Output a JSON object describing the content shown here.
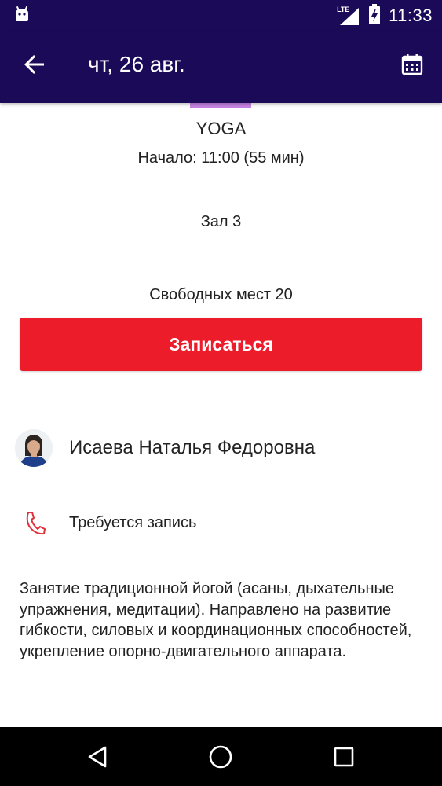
{
  "status_bar": {
    "time": "11:33",
    "network_label": "LTE",
    "left_icon": "android-debug-icon",
    "right_icons": [
      "lte-signal-icon",
      "battery-charging-icon"
    ]
  },
  "app_bar": {
    "title": "чт, 26 авг.",
    "back_icon": "arrow-back-icon",
    "calendar_icon": "calendar-icon",
    "background_color": "#1a0a57"
  },
  "session": {
    "accent_color": "#c984e5",
    "name": "YOGA",
    "start": "Начало: 11:00 (55 мин)",
    "hall": "Зал 3",
    "free_seats": "Свободных мест 20"
  },
  "signup_button": {
    "label": "Записаться",
    "color": "#ed1c2b"
  },
  "trainer": {
    "name": "Исаева Наталья Федоровна",
    "avatar_icon": "trainer-photo"
  },
  "booking": {
    "icon": "phone-icon",
    "text": "Требуется запись",
    "icon_color": "#e0303b"
  },
  "description": "Занятие традиционной йогой (асаны, дыхательные упражнения, медитации). Направлено на развитие гибкости, силовых и координационных способностей, укрепление опорно-двигательного аппарата.",
  "nav_bar": {
    "icons": [
      "nav-back-icon",
      "nav-home-icon",
      "nav-recents-icon"
    ]
  }
}
